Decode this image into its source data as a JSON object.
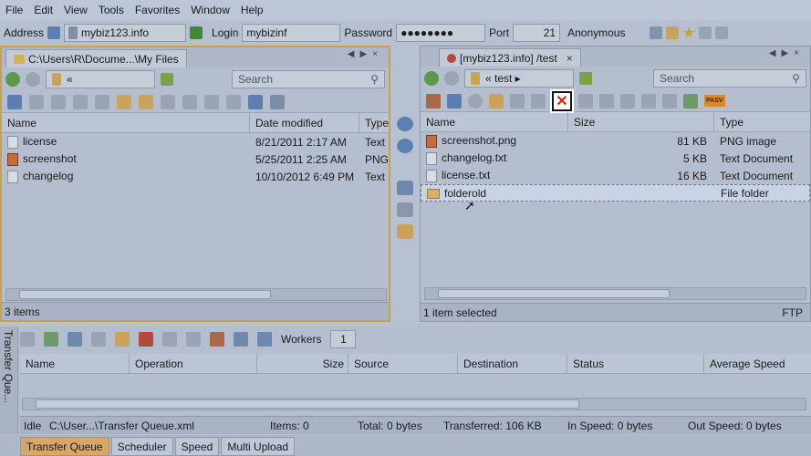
{
  "menu": [
    "File",
    "Edit",
    "View",
    "Tools",
    "Favorites",
    "Window",
    "Help"
  ],
  "address_bar": {
    "address_label": "Address",
    "host": "mybiz123.info",
    "login_label": "Login",
    "login": "mybizinf",
    "password_label": "Password",
    "password": "●●●●●●●●",
    "port_label": "Port",
    "port": "21",
    "mode": "Anonymous"
  },
  "left_pane": {
    "tab_label": "C:\\Users\\R\\Docume...\\My Files",
    "path": "«",
    "search_placeholder": "Search",
    "columns": [
      "Name",
      "Date modified",
      "Type"
    ],
    "rows": [
      {
        "name": "license",
        "date": "8/21/2011 2:17 AM",
        "type": "Text",
        "icon": "text-file-icon"
      },
      {
        "name": "screenshot",
        "date": "5/25/2011 2:25 AM",
        "type": "PNG",
        "icon": "image-file-icon"
      },
      {
        "name": "changelog",
        "date": "10/10/2012 6:49 PM",
        "type": "Text",
        "icon": "text-file-icon"
      }
    ],
    "status": "3 items"
  },
  "right_pane": {
    "tab_label": "[mybiz123.info] /test",
    "path": "« test ▸",
    "search_placeholder": "Search",
    "columns": [
      "Name",
      "Size",
      "Type"
    ],
    "rows": [
      {
        "name": "screenshot.png",
        "size": "81 KB",
        "type": "PNG image",
        "icon": "image-file-icon"
      },
      {
        "name": "changelog.txt",
        "size": "5 KB",
        "type": "Text Document",
        "icon": "text-file-icon"
      },
      {
        "name": "license.txt",
        "size": "16 KB",
        "type": "Text Document",
        "icon": "text-file-icon"
      },
      {
        "name": "folderold",
        "size": "",
        "type": "File folder",
        "icon": "folder-icon"
      }
    ],
    "status": "1 item selected",
    "protocol": "FTP",
    "pasv_label": "PASV"
  },
  "queue": {
    "side_label": "Transfer Que...",
    "workers_label": "Workers",
    "workers": "1",
    "columns": [
      "Name",
      "Operation",
      "Size",
      "Source",
      "Destination",
      "Status",
      "Average Speed"
    ],
    "status": {
      "state": "Idle",
      "file": "C:\\User...\\Transfer Queue.xml",
      "items": "Items: 0",
      "total": "Total: 0 bytes",
      "transferred": "Transferred: 106 KB",
      "in_speed": "In Speed: 0 bytes",
      "out_speed": "Out Speed: 0 bytes"
    },
    "tabs": [
      "Transfer Queue",
      "Scheduler",
      "Speed",
      "Multi Upload"
    ]
  }
}
